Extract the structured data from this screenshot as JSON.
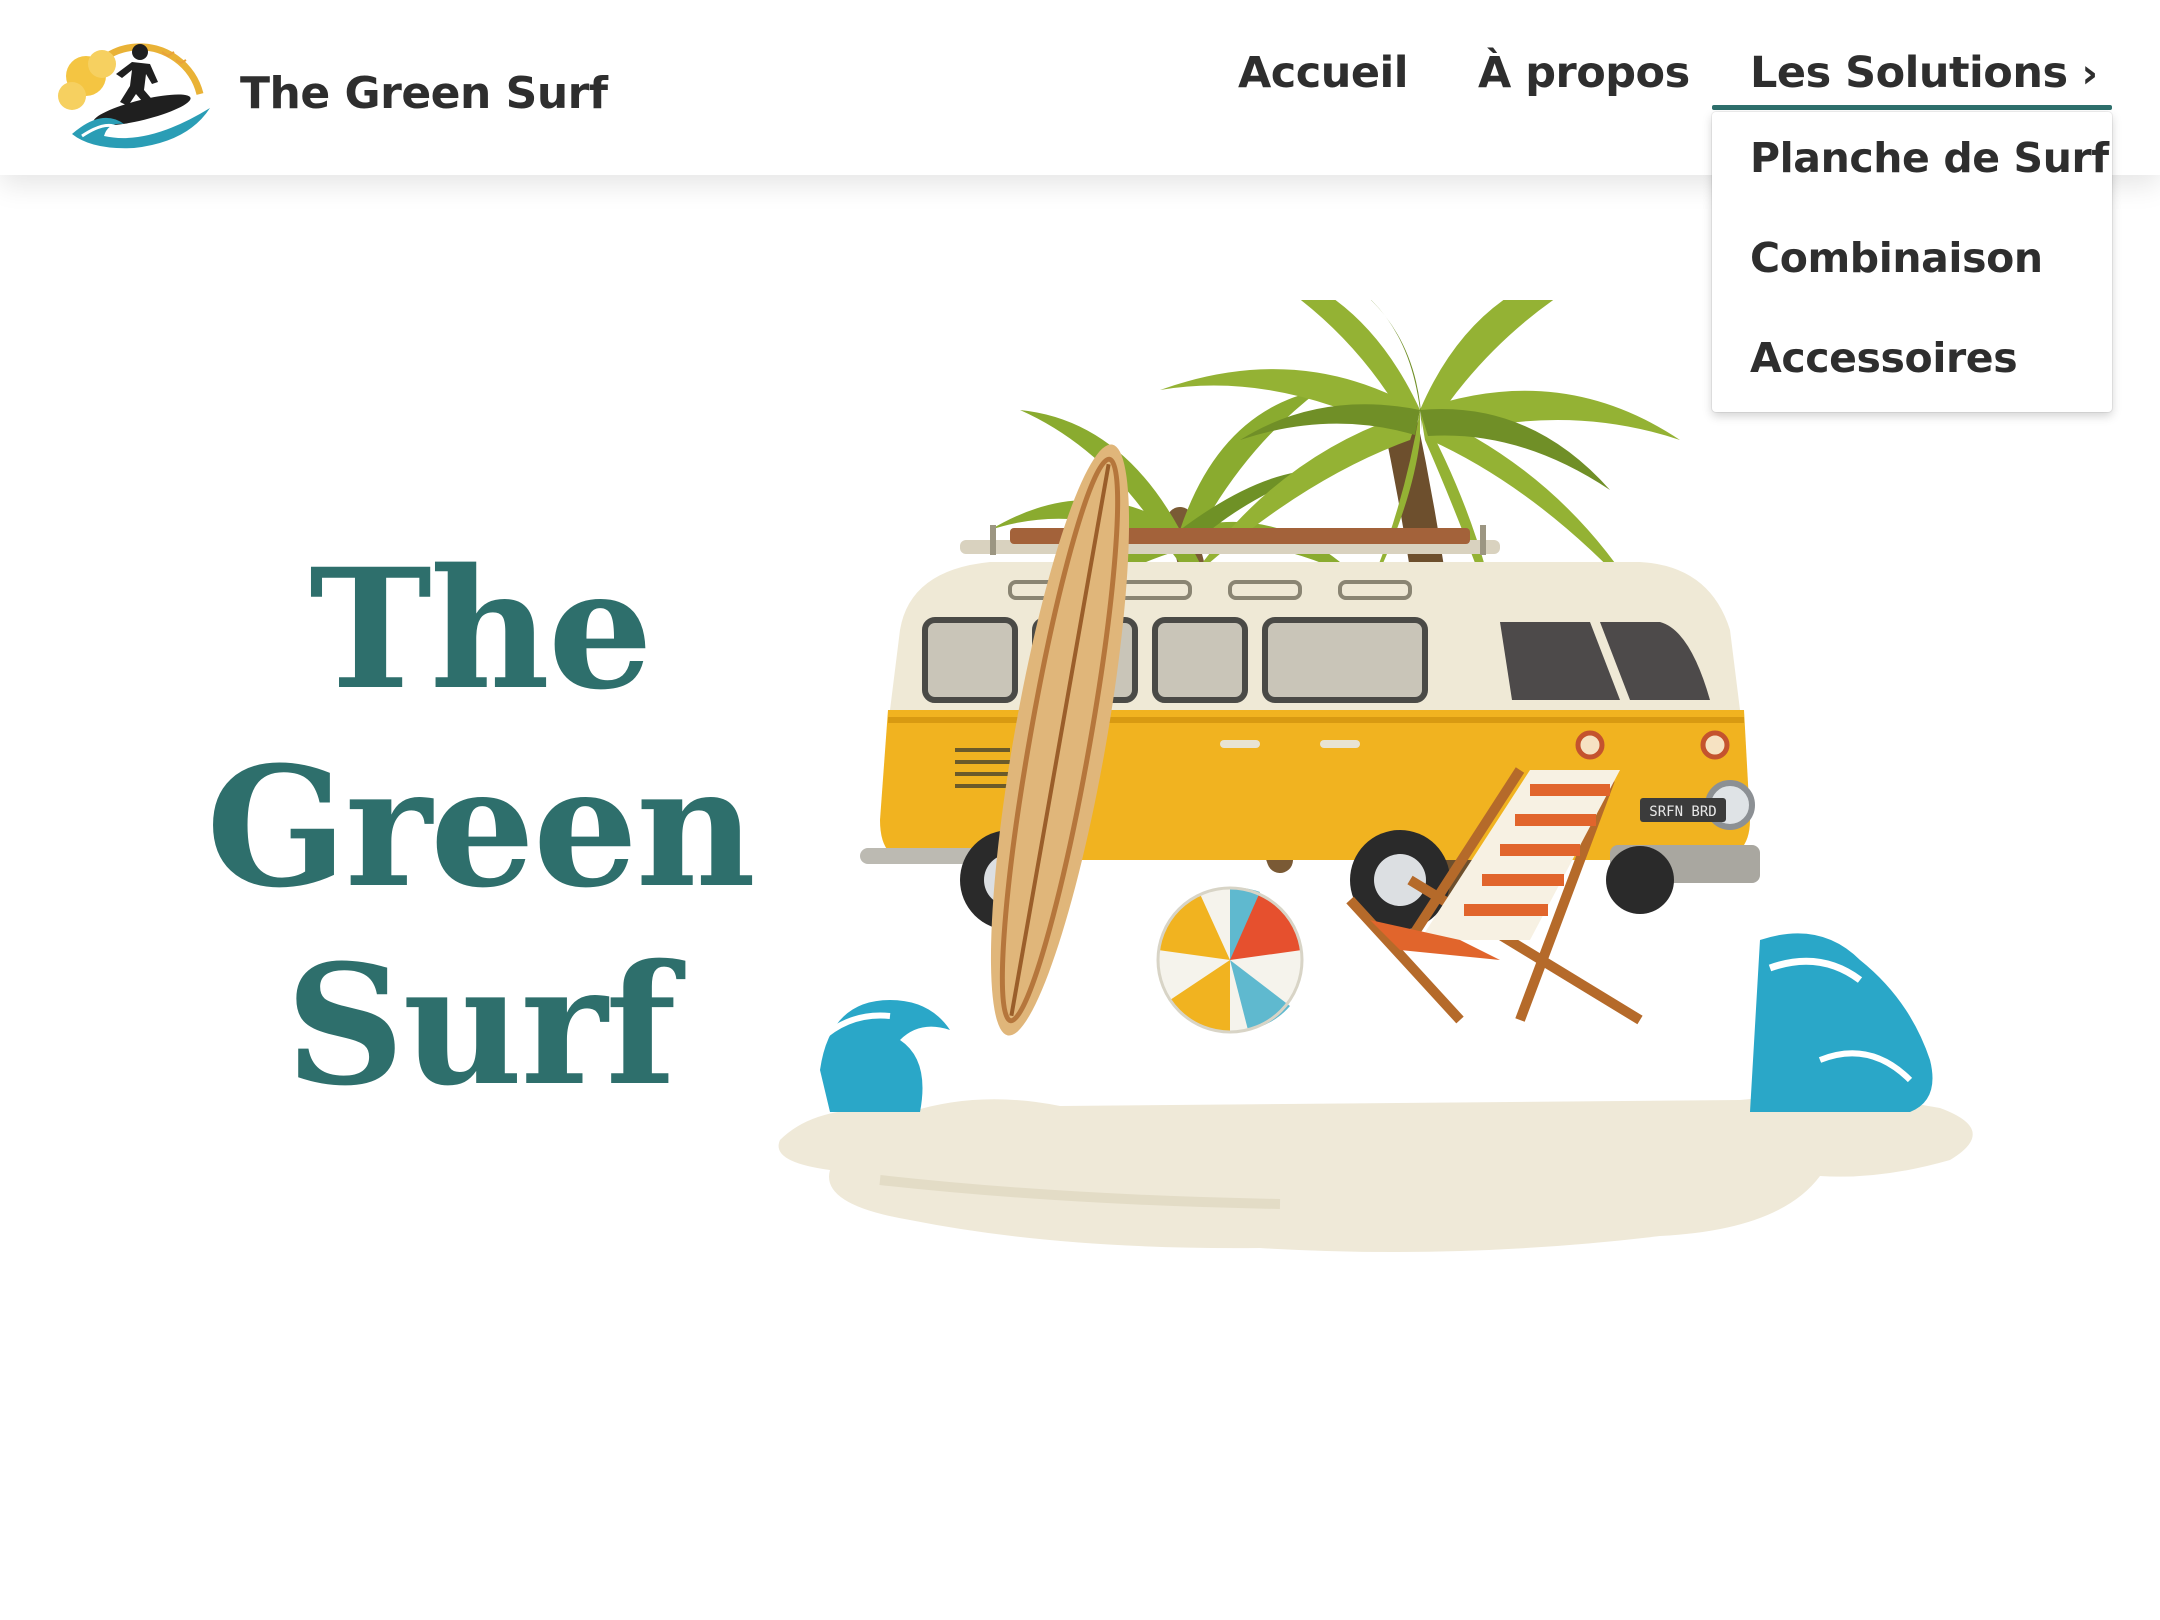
{
  "brand": {
    "name": "The Green Surf",
    "logo_icon": "surfer-logo-icon"
  },
  "nav": {
    "items": [
      {
        "label": "Accueil"
      },
      {
        "label": "À propos"
      },
      {
        "label": "Les Solutions",
        "icon": "chevron-right-icon",
        "active": true
      }
    ]
  },
  "dropdown": {
    "items": [
      {
        "label": "Planche de Surf"
      },
      {
        "label": "Combinaison"
      },
      {
        "label": "Accessoires"
      }
    ]
  },
  "hero": {
    "title_lines": [
      "The",
      "Green",
      "Surf"
    ],
    "illustration": "beach-van-illustration",
    "van_plate": "SRFN BRD"
  },
  "colors": {
    "accent": "#2e6f6c",
    "text": "#2e2e2e",
    "background": "#ffffff"
  }
}
